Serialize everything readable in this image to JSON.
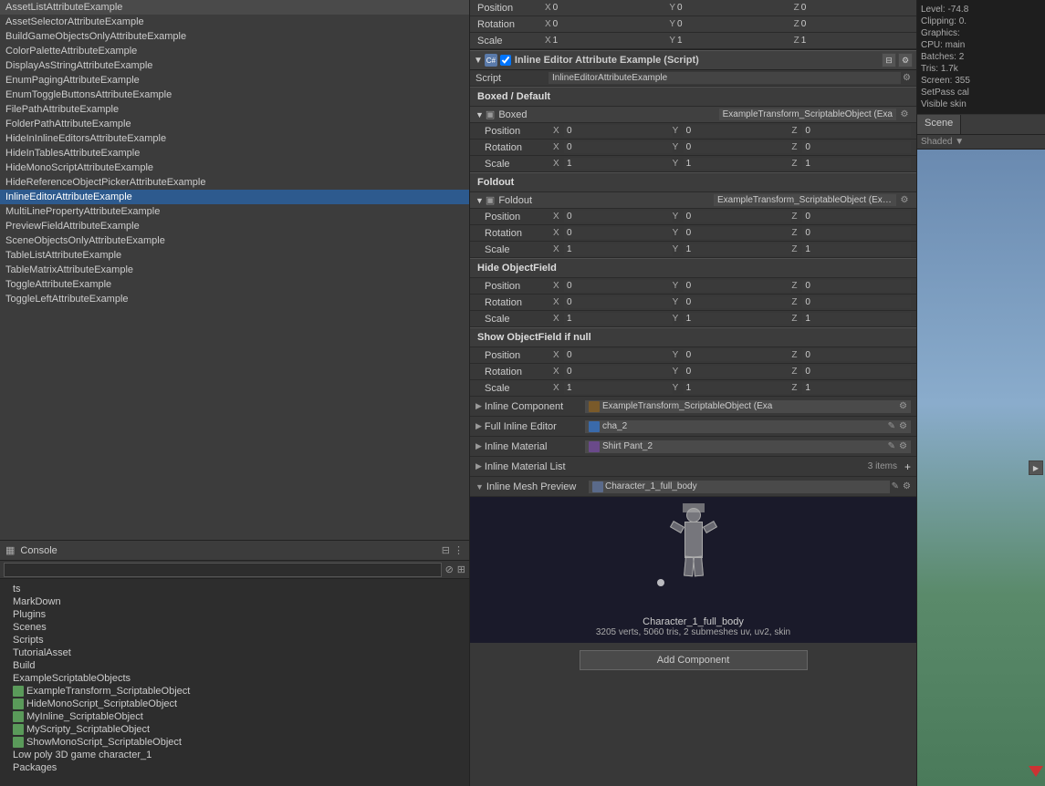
{
  "left_panel": {
    "items": [
      {
        "label": "AssetListAttributeExample",
        "selected": false
      },
      {
        "label": "AssetSelectorAttributeExample",
        "selected": false
      },
      {
        "label": "BuildGameObjectsOnlyAttributeExample",
        "selected": false
      },
      {
        "label": "ColorPaletteAttributeExample",
        "selected": false
      },
      {
        "label": "DisplayAsStringAttributeExample",
        "selected": false
      },
      {
        "label": "EnumPagingAttributeExample",
        "selected": false
      },
      {
        "label": "EnumToggleButtonsAttributeExample",
        "selected": false
      },
      {
        "label": "FilePathAttributeExample",
        "selected": false
      },
      {
        "label": "FolderPathAttributeExample",
        "selected": false
      },
      {
        "label": "HideInInlineEditorsAttributeExample",
        "selected": false
      },
      {
        "label": "HideInTablesAttributeExample",
        "selected": false
      },
      {
        "label": "HideMonoScriptAttributeExample",
        "selected": false
      },
      {
        "label": "HideReferenceObjectPickerAttributeExample",
        "selected": false
      },
      {
        "label": "InlineEditorAttributeExample",
        "selected": true
      },
      {
        "label": "MultiLinePropertyAttributeExample",
        "selected": false
      },
      {
        "label": "PreviewFieldAttributeExample",
        "selected": false
      },
      {
        "label": "SceneObjectsOnlyAttributeExample",
        "selected": false
      },
      {
        "label": "TableListAttributeExample",
        "selected": false
      },
      {
        "label": "TableMatrixAttributeExample",
        "selected": false
      },
      {
        "label": "ToggleAttributeExample",
        "selected": false
      },
      {
        "label": "ToggleLeftAttributeExample",
        "selected": false
      }
    ]
  },
  "console": {
    "header": "Console",
    "search_placeholder": "",
    "assets_section": {
      "header": "ts",
      "items": [
        {
          "label": "MarkDown",
          "indent": false,
          "icon": "none"
        },
        {
          "label": "Plugins",
          "indent": false,
          "icon": "none"
        },
        {
          "label": "Scenes",
          "indent": false,
          "icon": "none"
        },
        {
          "label": "Scripts",
          "indent": false,
          "icon": "none"
        },
        {
          "label": "TutorialAsset",
          "indent": false,
          "icon": "none"
        },
        {
          "label": "Build",
          "indent": false,
          "icon": "none"
        },
        {
          "label": "ExampleScriptableObjects",
          "indent": false,
          "icon": "none"
        },
        {
          "label": "ExampleTransform_ScriptableObject",
          "indent": false,
          "icon": "asset"
        },
        {
          "label": "HideMonoScript_ScriptableObject",
          "indent": false,
          "icon": "asset"
        },
        {
          "label": "MyInline_ScriptableObject",
          "indent": false,
          "icon": "asset"
        },
        {
          "label": "MyScripty_ScriptableObject",
          "indent": false,
          "icon": "asset"
        },
        {
          "label": "ShowMonoScript_ScriptableObject",
          "indent": false,
          "icon": "asset"
        },
        {
          "label": "Low poly 3D game character_1",
          "indent": false,
          "icon": "none"
        },
        {
          "label": "Packages",
          "indent": false,
          "icon": "none"
        }
      ]
    }
  },
  "inspector": {
    "top_transform": {
      "position": {
        "label": "Position",
        "x": "0",
        "y": "0",
        "z": "0"
      },
      "rotation": {
        "label": "Rotation",
        "x": "0",
        "y": "0",
        "z": "0"
      },
      "scale": {
        "label": "Scale",
        "x": "1",
        "y": "1",
        "z": "1"
      }
    },
    "component_title": "Inline Editor Attribute Example (Script)",
    "script_label": "Script",
    "script_value": "InlineEditorAttributeExample",
    "sections": [
      {
        "id": "boxed_default",
        "header": "Boxed / Default",
        "sub_components": [
          {
            "label": "Boxed",
            "value": "ExampleTransform_ScriptableObject (Exam",
            "has_settings": true,
            "fields": [
              {
                "label": "Position",
                "x": "0",
                "y": "0",
                "z": "0"
              },
              {
                "label": "Rotation",
                "x": "0",
                "y": "0",
                "z": "0"
              },
              {
                "label": "Scale",
                "x": "1",
                "y": "1",
                "z": "1"
              }
            ]
          }
        ]
      },
      {
        "id": "foldout",
        "header": "Foldout",
        "sub_components": [
          {
            "label": "Foldout",
            "value": "ExampleTransform_ScriptableObject (Examp",
            "has_settings": true,
            "fields": [
              {
                "label": "Position",
                "x": "0",
                "y": "0",
                "z": "0"
              },
              {
                "label": "Rotation",
                "x": "0",
                "y": "0",
                "z": "0"
              },
              {
                "label": "Scale",
                "x": "1",
                "y": "1",
                "z": "1"
              }
            ]
          }
        ]
      },
      {
        "id": "hide_objectfield",
        "header": "Hide ObjectField",
        "fields": [
          {
            "label": "Position",
            "x": "0",
            "y": "0",
            "z": "0"
          },
          {
            "label": "Rotation",
            "x": "0",
            "y": "0",
            "z": "0"
          },
          {
            "label": "Scale",
            "x": "1",
            "y": "1",
            "z": "1"
          }
        ]
      },
      {
        "id": "show_objectfield",
        "header": "Show ObjectField if null",
        "fields": [
          {
            "label": "Position",
            "x": "0",
            "y": "0",
            "z": "0"
          },
          {
            "label": "Rotation",
            "x": "0",
            "y": "0",
            "z": "0"
          },
          {
            "label": "Scale",
            "x": "1",
            "y": "1",
            "z": "1"
          }
        ]
      }
    ],
    "inline_component": {
      "label": "Inline Component",
      "value": "ExampleTransform_ScriptableObject (Exa",
      "has_settings": true
    },
    "full_inline_editor": {
      "label": "Full Inline Editor",
      "value": "cha_2",
      "has_edit": true,
      "has_settings": true
    },
    "inline_material": {
      "label": "Inline Material",
      "value": "Shirt Pant_2",
      "has_edit": true,
      "has_settings": true
    },
    "inline_material_list": {
      "label": "Inline Material List",
      "count": "3 items",
      "has_add": true
    },
    "inline_mesh_preview": {
      "label": "Inline Mesh Preview",
      "value": "Character_1_full_body",
      "has_edit": true,
      "has_settings": true,
      "mesh_name": "Character_1_full_body",
      "mesh_info": "3205 verts, 5060 tris, 2 submeshes   uv, uv2, skin"
    },
    "add_component_label": "Add Component"
  },
  "right_panel": {
    "stats": {
      "level": "Level: -74.8",
      "clipping": "Clipping: 0.",
      "graphics_title": "Graphics:",
      "cpu": "CPU: main",
      "batches": "Batches: 2",
      "tris": "Tris: 1.7k",
      "screen": "Screen: 355",
      "setpass": "SetPass cal",
      "visible": "Visible skin"
    },
    "scene_tab": "Scene",
    "shaded_label": "Shaded"
  }
}
